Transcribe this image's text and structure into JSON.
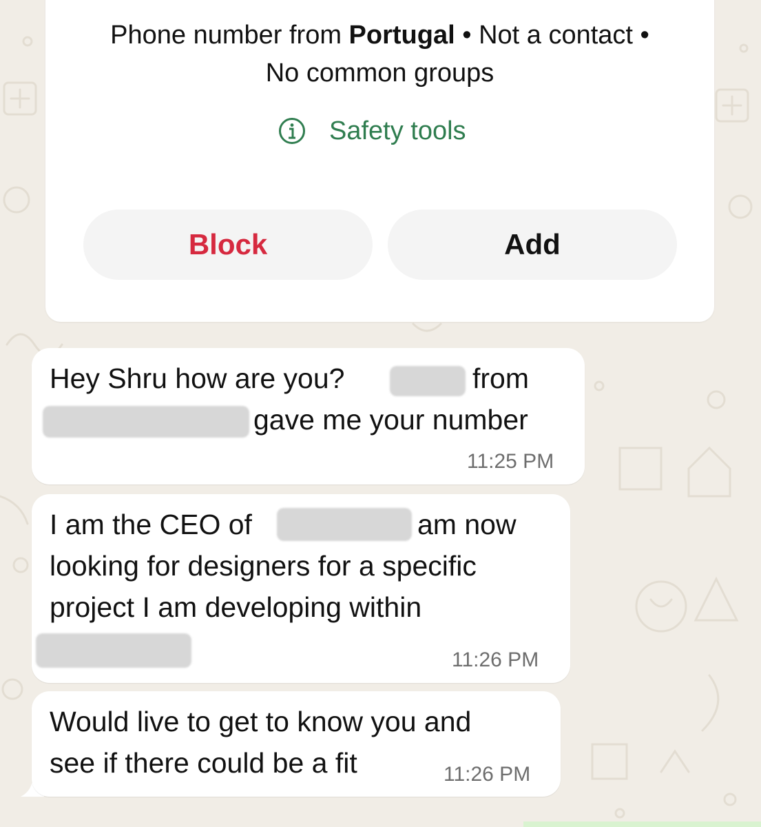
{
  "contact_info": {
    "prefix": "Phone number from ",
    "country": "Portugal",
    "suffix": " • Not a contact •",
    "line2": "No common groups",
    "safety_tools_label": "Safety tools"
  },
  "actions": {
    "block_label": "Block",
    "add_label": "Add"
  },
  "messages": [
    {
      "line1_a": "Hey Shru how are you?",
      "line1_b": "from",
      "line2_b": "gave me your number",
      "time": "11:25 PM"
    },
    {
      "line1_a": "I am the CEO of",
      "line1_b": "am now",
      "line2": "looking for designers for a specific",
      "line3": "project I am developing within",
      "time": "11:26 PM"
    },
    {
      "line1": "Would live to get to know you and",
      "line2": "see if there could be a fit",
      "time": "11:26 PM"
    }
  ],
  "colors": {
    "background": "#f1ede6",
    "bubble": "#ffffff",
    "block_red": "#d6293f",
    "safety_green": "#2f7d4f",
    "redaction_gray": "#d7d7d7"
  }
}
